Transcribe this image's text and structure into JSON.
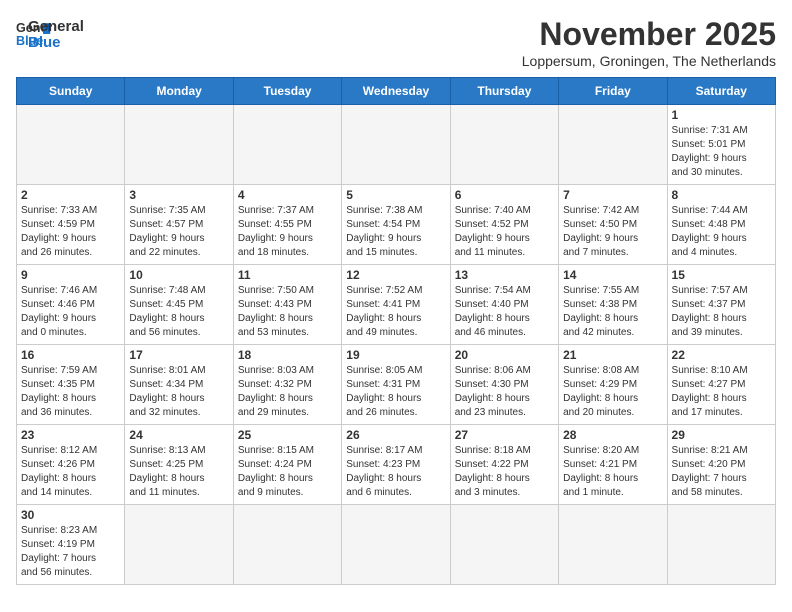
{
  "header": {
    "logo_general": "General",
    "logo_blue": "Blue",
    "month": "November 2025",
    "location": "Loppersum, Groningen, The Netherlands"
  },
  "weekdays": [
    "Sunday",
    "Monday",
    "Tuesday",
    "Wednesday",
    "Thursday",
    "Friday",
    "Saturday"
  ],
  "weeks": [
    [
      {
        "day": "",
        "info": ""
      },
      {
        "day": "",
        "info": ""
      },
      {
        "day": "",
        "info": ""
      },
      {
        "day": "",
        "info": ""
      },
      {
        "day": "",
        "info": ""
      },
      {
        "day": "",
        "info": ""
      },
      {
        "day": "1",
        "info": "Sunrise: 7:31 AM\nSunset: 5:01 PM\nDaylight: 9 hours\nand 30 minutes."
      }
    ],
    [
      {
        "day": "2",
        "info": "Sunrise: 7:33 AM\nSunset: 4:59 PM\nDaylight: 9 hours\nand 26 minutes."
      },
      {
        "day": "3",
        "info": "Sunrise: 7:35 AM\nSunset: 4:57 PM\nDaylight: 9 hours\nand 22 minutes."
      },
      {
        "day": "4",
        "info": "Sunrise: 7:37 AM\nSunset: 4:55 PM\nDaylight: 9 hours\nand 18 minutes."
      },
      {
        "day": "5",
        "info": "Sunrise: 7:38 AM\nSunset: 4:54 PM\nDaylight: 9 hours\nand 15 minutes."
      },
      {
        "day": "6",
        "info": "Sunrise: 7:40 AM\nSunset: 4:52 PM\nDaylight: 9 hours\nand 11 minutes."
      },
      {
        "day": "7",
        "info": "Sunrise: 7:42 AM\nSunset: 4:50 PM\nDaylight: 9 hours\nand 7 minutes."
      },
      {
        "day": "8",
        "info": "Sunrise: 7:44 AM\nSunset: 4:48 PM\nDaylight: 9 hours\nand 4 minutes."
      }
    ],
    [
      {
        "day": "9",
        "info": "Sunrise: 7:46 AM\nSunset: 4:46 PM\nDaylight: 9 hours\nand 0 minutes."
      },
      {
        "day": "10",
        "info": "Sunrise: 7:48 AM\nSunset: 4:45 PM\nDaylight: 8 hours\nand 56 minutes."
      },
      {
        "day": "11",
        "info": "Sunrise: 7:50 AM\nSunset: 4:43 PM\nDaylight: 8 hours\nand 53 minutes."
      },
      {
        "day": "12",
        "info": "Sunrise: 7:52 AM\nSunset: 4:41 PM\nDaylight: 8 hours\nand 49 minutes."
      },
      {
        "day": "13",
        "info": "Sunrise: 7:54 AM\nSunset: 4:40 PM\nDaylight: 8 hours\nand 46 minutes."
      },
      {
        "day": "14",
        "info": "Sunrise: 7:55 AM\nSunset: 4:38 PM\nDaylight: 8 hours\nand 42 minutes."
      },
      {
        "day": "15",
        "info": "Sunrise: 7:57 AM\nSunset: 4:37 PM\nDaylight: 8 hours\nand 39 minutes."
      }
    ],
    [
      {
        "day": "16",
        "info": "Sunrise: 7:59 AM\nSunset: 4:35 PM\nDaylight: 8 hours\nand 36 minutes."
      },
      {
        "day": "17",
        "info": "Sunrise: 8:01 AM\nSunset: 4:34 PM\nDaylight: 8 hours\nand 32 minutes."
      },
      {
        "day": "18",
        "info": "Sunrise: 8:03 AM\nSunset: 4:32 PM\nDaylight: 8 hours\nand 29 minutes."
      },
      {
        "day": "19",
        "info": "Sunrise: 8:05 AM\nSunset: 4:31 PM\nDaylight: 8 hours\nand 26 minutes."
      },
      {
        "day": "20",
        "info": "Sunrise: 8:06 AM\nSunset: 4:30 PM\nDaylight: 8 hours\nand 23 minutes."
      },
      {
        "day": "21",
        "info": "Sunrise: 8:08 AM\nSunset: 4:29 PM\nDaylight: 8 hours\nand 20 minutes."
      },
      {
        "day": "22",
        "info": "Sunrise: 8:10 AM\nSunset: 4:27 PM\nDaylight: 8 hours\nand 17 minutes."
      }
    ],
    [
      {
        "day": "23",
        "info": "Sunrise: 8:12 AM\nSunset: 4:26 PM\nDaylight: 8 hours\nand 14 minutes."
      },
      {
        "day": "24",
        "info": "Sunrise: 8:13 AM\nSunset: 4:25 PM\nDaylight: 8 hours\nand 11 minutes."
      },
      {
        "day": "25",
        "info": "Sunrise: 8:15 AM\nSunset: 4:24 PM\nDaylight: 8 hours\nand 9 minutes."
      },
      {
        "day": "26",
        "info": "Sunrise: 8:17 AM\nSunset: 4:23 PM\nDaylight: 8 hours\nand 6 minutes."
      },
      {
        "day": "27",
        "info": "Sunrise: 8:18 AM\nSunset: 4:22 PM\nDaylight: 8 hours\nand 3 minutes."
      },
      {
        "day": "28",
        "info": "Sunrise: 8:20 AM\nSunset: 4:21 PM\nDaylight: 8 hours\nand 1 minute."
      },
      {
        "day": "29",
        "info": "Sunrise: 8:21 AM\nSunset: 4:20 PM\nDaylight: 7 hours\nand 58 minutes."
      }
    ],
    [
      {
        "day": "30",
        "info": "Sunrise: 8:23 AM\nSunset: 4:19 PM\nDaylight: 7 hours\nand 56 minutes."
      },
      {
        "day": "",
        "info": ""
      },
      {
        "day": "",
        "info": ""
      },
      {
        "day": "",
        "info": ""
      },
      {
        "day": "",
        "info": ""
      },
      {
        "day": "",
        "info": ""
      },
      {
        "day": "",
        "info": ""
      }
    ]
  ]
}
